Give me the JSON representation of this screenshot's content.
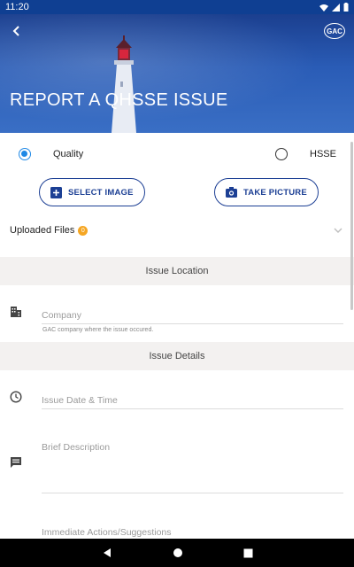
{
  "status_bar": {
    "time": "11:20"
  },
  "header": {
    "title": "REPORT A QHSSE ISSUE",
    "logo_text": "GAC"
  },
  "issue_type": {
    "options": [
      {
        "label": "Quality",
        "selected": true
      },
      {
        "label": "HSSE",
        "selected": false
      }
    ]
  },
  "actions": {
    "select_image": "SELECT IMAGE",
    "take_picture": "TAKE PICTURE"
  },
  "uploaded": {
    "label": "Uploaded Files",
    "count": "0"
  },
  "sections": {
    "location": "Issue Location",
    "details": "Issue Details"
  },
  "fields": {
    "company": {
      "placeholder": "Company",
      "helper": "GAC company where the issue occured."
    },
    "date_time": {
      "placeholder": "Issue Date & Time"
    },
    "description": {
      "placeholder": "Brief Description"
    },
    "actions_suggestions": {
      "placeholder": "Immediate Actions/Suggestions"
    }
  },
  "colors": {
    "brand": "#1c3f94",
    "radio_active": "#1e88e5",
    "badge": "#f5a623",
    "section_bg": "#f3f1f0"
  },
  "icons": [
    "back-arrow-icon",
    "gac-logo",
    "add-image-icon",
    "camera-icon",
    "chevron-down-icon",
    "building-icon",
    "clock-icon",
    "comment-icon"
  ]
}
